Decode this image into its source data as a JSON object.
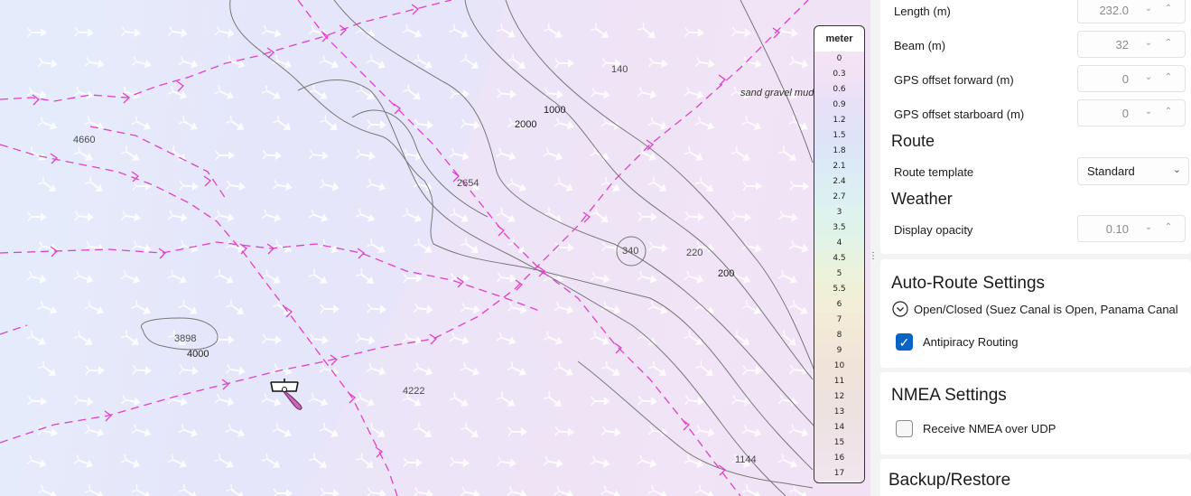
{
  "map": {
    "depth_labels": [
      "140",
      "1000",
      "2000",
      "4660",
      "2654",
      "340",
      "220",
      "200",
      "3898",
      "4000",
      "4222",
      "1144"
    ],
    "seabed_note": "sand gravel mud"
  },
  "legend": {
    "title": "meter",
    "levels": [
      "0",
      "0.3",
      "0.6",
      "0.9",
      "1.2",
      "1.5",
      "1.8",
      "2.1",
      "2.4",
      "2.7",
      "3",
      "3.5",
      "4",
      "4.5",
      "5",
      "5.5",
      "6",
      "7",
      "8",
      "9",
      "10",
      "11",
      "12",
      "13",
      "14",
      "15",
      "16",
      "17"
    ],
    "colors": [
      "#f3e3f5",
      "#f1e2f5",
      "#ece1f6",
      "#e8e0f6",
      "#e4e2f7",
      "#dfe3f7",
      "#dde6f7",
      "#dce9f6",
      "#dcedf4",
      "#ddf0f1",
      "#def2ee",
      "#e0f3ea",
      "#e3f3e5",
      "#e7f3df",
      "#ecf2dc",
      "#f0f0d9",
      "#f2eed8",
      "#f3ebd8",
      "#f2e8d8",
      "#f1e6d9",
      "#f0e4da",
      "#efe3dc",
      "#eee2de",
      "#eee2e1",
      "#eee3e4",
      "#efe3e7",
      "#efe4e9",
      "#efe5eb"
    ]
  },
  "panel": {
    "vessel": {
      "length": {
        "label": "Length (m)",
        "value": "232.0"
      },
      "beam": {
        "label": "Beam (m)",
        "value": "32"
      },
      "gps_forward": {
        "label": "GPS offset forward (m)",
        "value": "0"
      },
      "gps_starboard": {
        "label": "GPS offset starboard (m)",
        "value": "0"
      }
    },
    "route": {
      "heading": "Route",
      "template_label": "Route template",
      "template_value": "Standard"
    },
    "weather": {
      "heading": "Weather",
      "opacity_label": "Display opacity",
      "opacity_value": "0.10"
    },
    "auto_route": {
      "heading": "Auto-Route Settings",
      "canals_text": "Open/Closed (Suez Canal is Open,  Panama Canal",
      "antipiracy_label": "Antipiracy Routing",
      "antipiracy_checked": true
    },
    "nmea": {
      "heading": "NMEA Settings",
      "udp_label": "Receive NMEA over UDP",
      "udp_checked": false
    },
    "backup": {
      "heading": "Backup/Restore"
    }
  },
  "icons": {
    "spin_down": "chevron-down-icon",
    "spin_up": "chevron-up-icon",
    "dropdown": "chevron-down-icon",
    "expand": "expand-circle-icon",
    "check": "checkmark-icon",
    "vessel": "vessel-icon"
  },
  "colors": {
    "accent": "#0a64c8",
    "route_line": "#e040c8",
    "contour": "#777777",
    "vessel_fill": "#d060c0"
  }
}
